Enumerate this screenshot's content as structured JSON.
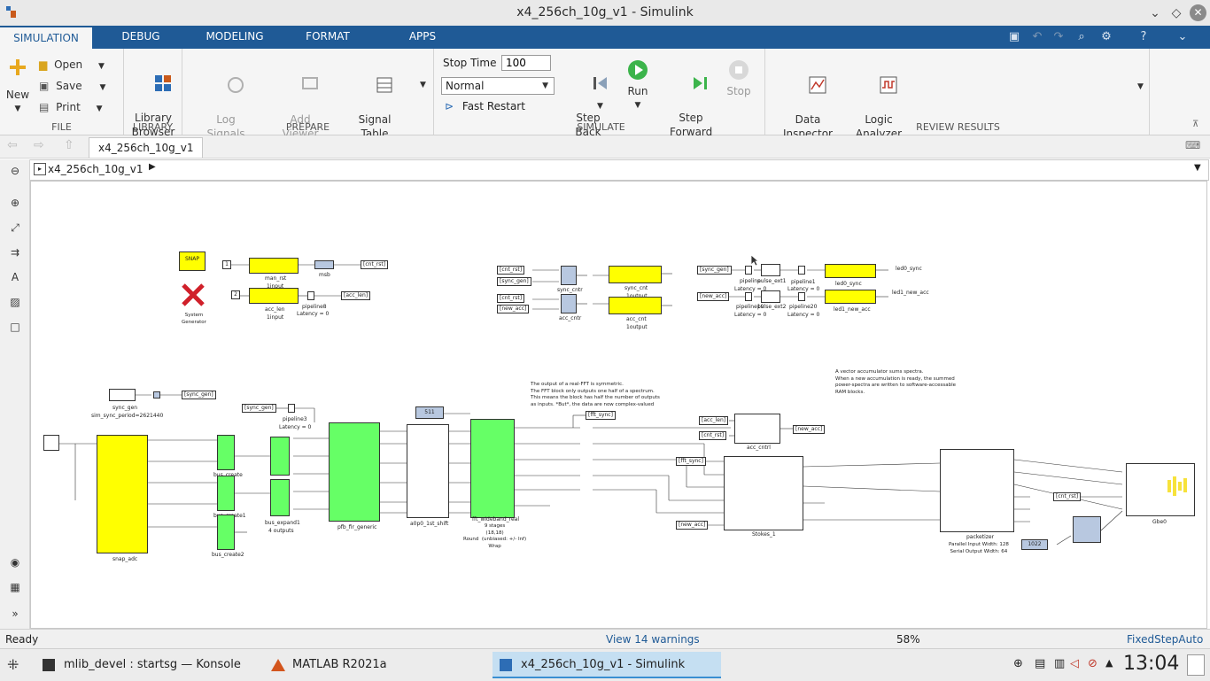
{
  "window": {
    "title": "x4_256ch_10g_v1 - Simulink"
  },
  "ribbon": {
    "tabs": [
      "SIMULATION",
      "DEBUG",
      "MODELING",
      "FORMAT",
      "APPS"
    ],
    "active_tab": "SIMULATION",
    "file": {
      "section_label": "FILE",
      "new_label": "New",
      "open_label": "Open",
      "save_label": "Save",
      "print_label": "Print"
    },
    "library": {
      "section_label": "LIBRARY",
      "browser_label": "Library\nBrowser"
    },
    "prepare": {
      "section_label": "PREPARE",
      "log_signals_label": "Log\nSignals",
      "add_viewer_label": "Add\nViewer",
      "signal_table_label": "Signal\nTable"
    },
    "simulate": {
      "section_label": "SIMULATE",
      "stop_time_label": "Stop Time",
      "stop_time_value": "100",
      "mode_value": "Normal",
      "fast_restart_label": "Fast Restart",
      "step_back_label": "Step\nBack",
      "run_label": "Run",
      "step_forward_label": "Step\nForward",
      "stop_label": "Stop"
    },
    "review": {
      "section_label": "REVIEW RESULTS",
      "data_inspector_label": "Data\nInspector",
      "logic_analyzer_label": "Logic\nAnalyzer"
    }
  },
  "document_tab": "x4_256ch_10g_v1",
  "breadcrumb": "x4_256ch_10g_v1",
  "model": {
    "snap": "SNAP",
    "system_generator": "System\nGenerator",
    "man_rst": "man_rst",
    "man_rst_sub": "1input",
    "msb": "msb",
    "cnt_rst": "[cnt_rst]",
    "acc_len_block": "acc_len",
    "acc_len_sub": "1input",
    "acc_len_tag": "[acc_len]",
    "pipeline8": "pipeline8",
    "latency0": "Latency = 0",
    "const1": "1",
    "const2": "2",
    "sync_cntr": "sync_cntr",
    "acc_cntr": "acc_cntr",
    "sync_cnt": "sync_cnt",
    "sync_cnt_sub": "1output",
    "acc_cnt": "acc_cnt",
    "acc_cnt_sub": "1output",
    "cnt_rst_tag": "[cnt_rst]",
    "sync_gen_tag": "[sync_gen]",
    "new_acc_tag": "[new_acc]",
    "pipeline": "pipeline",
    "pipeline1": "pipeline1",
    "pipeline19": "pipeline19",
    "pipeline20": "pipeline20",
    "pulse_ext1": "pulse_ext1",
    "pulse_ext2": "pulse_ext2",
    "led0_sync": "led0_sync",
    "led1_new_acc": "led1_new_acc",
    "led0_sync_out": "led0_sync",
    "led1_new_acc_out": "led1_new_acc",
    "sync_gen": "sync_gen",
    "sync_gen_period": "sim_sync_period=2621440",
    "pipeline3": "pipeline3",
    "snap_adc": "snap_adc",
    "bus_create": "bus_create",
    "bus_create1": "bus_create1",
    "bus_create2": "bus_create2",
    "bus_expand1": "bus_expand1",
    "bus_expand_sub": "4 outputs",
    "pfb_fir_generic": "pfb_fir_generic",
    "a0p0_1st_shift": "a0p0_1st_shift",
    "const511": "511",
    "fft_wideband_real": "fft_wideband_real",
    "fft_sub": "9 stages\n(18,18)\nRound  (unbiased: +/- Inf)\nWrap",
    "fft_note": "The output of a real-FFT is symmetric.\nThe FFT block only outputs one half of a spectrum.\nThis means the block has half the number of outputs\nas inputs. *But*, the data are now complex-valued",
    "fft_sync_tag": "[fft_sync]",
    "acc_cntrl": "acc_cntrl",
    "new_acc_out": "[new_acc]",
    "acc_len_in": "[acc_len]",
    "cnt_rst_in": "[cnt_rst]",
    "fft_sync_in": "[fft_sync]",
    "new_acc_in": "[new_acc]",
    "stokes": "Stokes_1",
    "acc_note": "A vector accumulator sums spectra.\nWhen a new accumulation is ready, the summed\npower-spectra are written to software-accessable\nRAM blocks.",
    "packetizer": "packetizer",
    "packetizer_sub": "Parallel Input Width: 128\nSerial Output Width: 64",
    "gbe0": "Gbe0",
    "const1022": "1022",
    "cnt_rst_gbe": "[cnt_rst]"
  },
  "status": {
    "ready": "Ready",
    "warnings": "View 14 warnings",
    "zoom": "58%",
    "solver": "FixedStepAuto"
  },
  "taskbar": {
    "items": [
      "mlib_devel : startsg — Konsole",
      "MATLAB R2021a",
      "x4_256ch_10g_v1 - Simulink"
    ],
    "clock": "13:04"
  },
  "colors": {
    "ribbon_blue": "#1f5a96",
    "xilinx_yellow": "#ffff00",
    "block_green": "#66ff66",
    "link_blue": "#1f5a96"
  }
}
